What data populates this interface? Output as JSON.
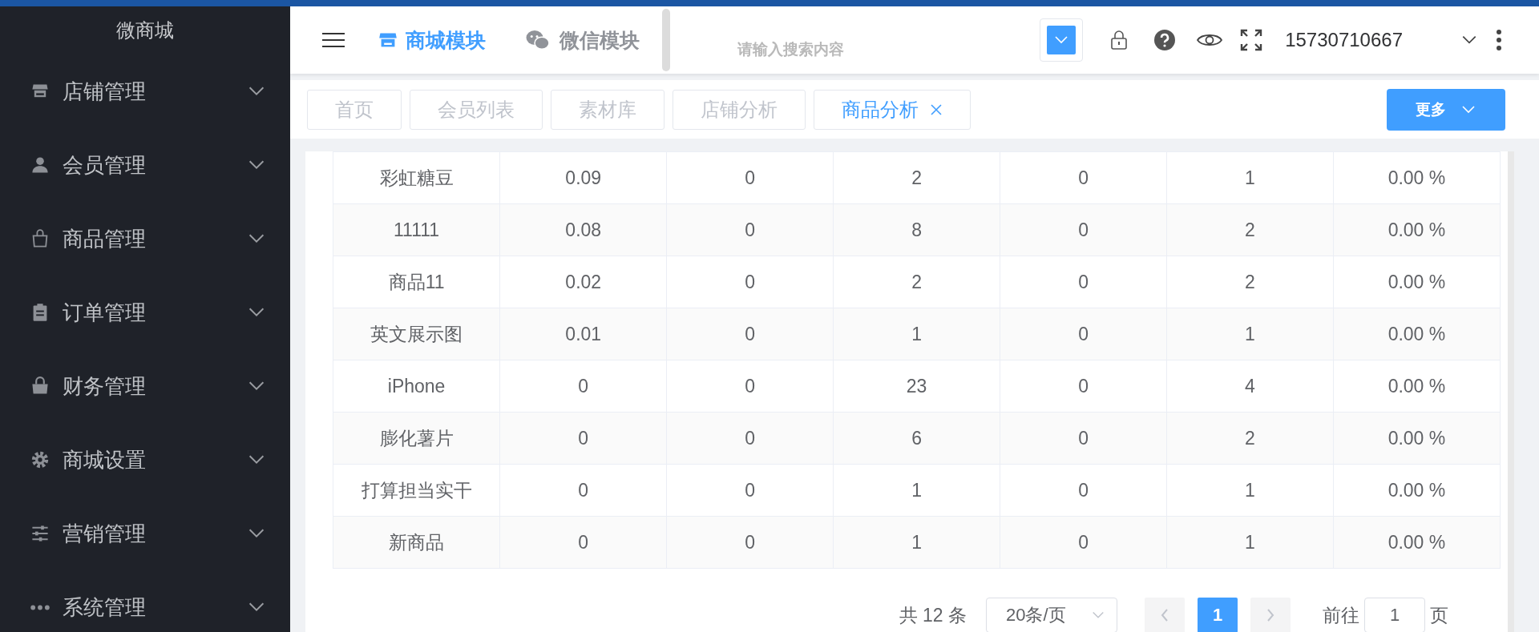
{
  "app_title": "微商城",
  "sidebar": {
    "items": [
      {
        "label": "店铺管理"
      },
      {
        "label": "会员管理"
      },
      {
        "label": "商品管理"
      },
      {
        "label": "订单管理"
      },
      {
        "label": "财务管理"
      },
      {
        "label": "商城设置"
      },
      {
        "label": "营销管理"
      },
      {
        "label": "系统管理"
      }
    ]
  },
  "header": {
    "modules": [
      {
        "label": "商城模块",
        "selected": true
      },
      {
        "label": "微信模块",
        "selected": false
      }
    ],
    "search": {
      "placeholder": "请输入搜索内容"
    },
    "user": "15730710667"
  },
  "page_tabs": [
    {
      "label": "首页",
      "selected": false
    },
    {
      "label": "会员列表",
      "selected": false
    },
    {
      "label": "素材库",
      "selected": false
    },
    {
      "label": "店铺分析",
      "selected": false
    },
    {
      "label": "商品分析",
      "selected": true
    }
  ],
  "more_button": "更多",
  "table": {
    "rows": [
      [
        "彩虹糖豆",
        "0.09",
        "0",
        "2",
        "0",
        "1",
        "0.00 %"
      ],
      [
        "11111",
        "0.08",
        "0",
        "8",
        "0",
        "2",
        "0.00 %"
      ],
      [
        "商品11",
        "0.02",
        "0",
        "2",
        "0",
        "2",
        "0.00 %"
      ],
      [
        "英文展示图",
        "0.01",
        "0",
        "1",
        "0",
        "1",
        "0.00 %"
      ],
      [
        "iPhone",
        "0",
        "0",
        "23",
        "0",
        "4",
        "0.00 %"
      ],
      [
        "膨化薯片",
        "0",
        "0",
        "6",
        "0",
        "2",
        "0.00 %"
      ],
      [
        "打算担当实干",
        "0",
        "0",
        "1",
        "0",
        "1",
        "0.00 %"
      ],
      [
        "新商品",
        "0",
        "0",
        "1",
        "0",
        "1",
        "0.00 %"
      ]
    ]
  },
  "pagination": {
    "total": "共 12 条",
    "page_size": "20条/页",
    "pages": [
      {
        "label": "1",
        "selected": true
      }
    ],
    "goto_label": "前往",
    "goto_value": "1",
    "goto_suffix": "页"
  }
}
